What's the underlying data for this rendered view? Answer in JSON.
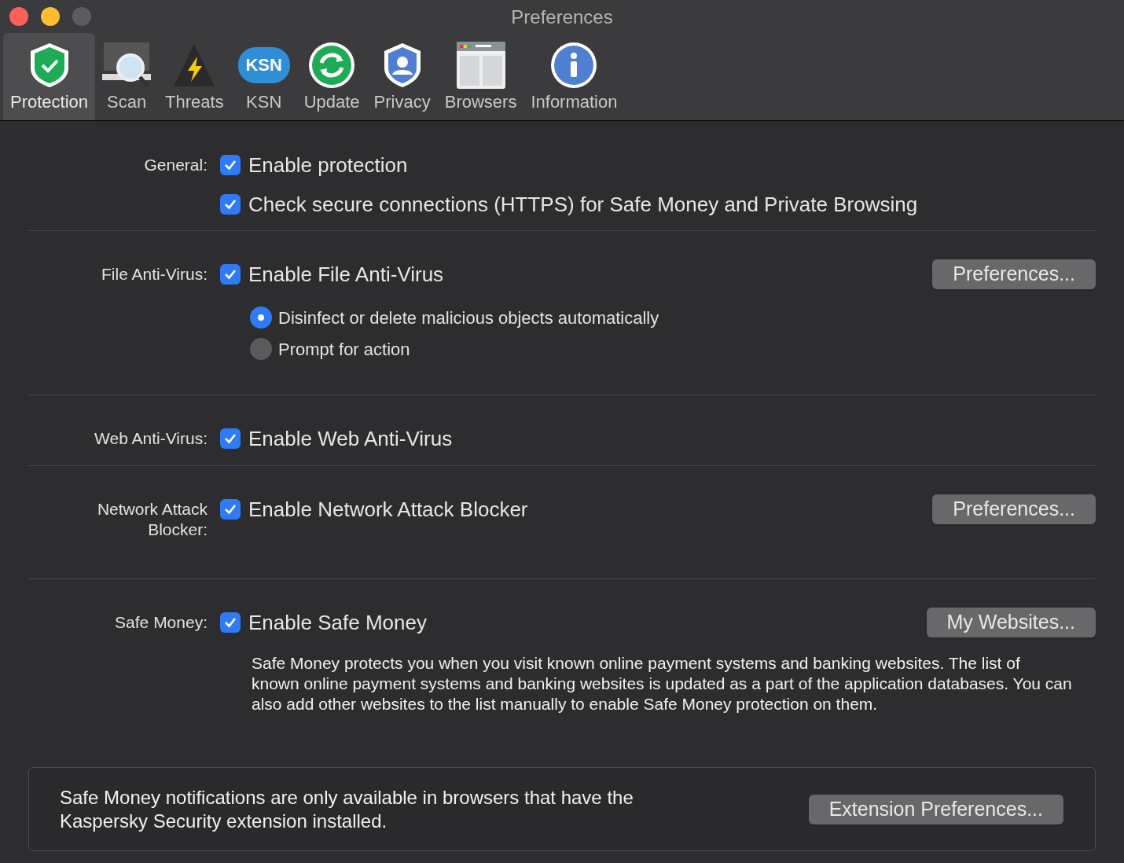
{
  "window": {
    "title": "Preferences"
  },
  "toolbar": [
    {
      "label": "Protection",
      "selected": true
    },
    {
      "label": "Scan",
      "selected": false
    },
    {
      "label": "Threats",
      "selected": false
    },
    {
      "label": "KSN",
      "icon_text": "KSN",
      "selected": false
    },
    {
      "label": "Update",
      "selected": false
    },
    {
      "label": "Privacy",
      "selected": false
    },
    {
      "label": "Browsers",
      "selected": false
    },
    {
      "label": "Information",
      "selected": false
    }
  ],
  "sections": [
    {
      "label": "General:",
      "checkboxes": [
        {
          "label": "Enable protection",
          "checked": true
        },
        {
          "label": "Check secure connections (HTTPS) for Safe Money and Private Browsing",
          "checked": true
        }
      ]
    },
    {
      "label": "File Anti-Virus:",
      "checkboxes": [
        {
          "label": "Enable File Anti-Virus",
          "checked": true
        }
      ],
      "button": "Preferences...",
      "radios": [
        {
          "label": "Disinfect or delete malicious objects automatically",
          "selected": true
        },
        {
          "label": "Prompt for action",
          "selected": false
        }
      ]
    },
    {
      "label": "Web Anti-Virus:",
      "checkboxes": [
        {
          "label": "Enable Web Anti-Virus",
          "checked": true
        }
      ]
    },
    {
      "label": "Network Attack Blocker:",
      "checkboxes": [
        {
          "label": "Enable Network Attack Blocker",
          "checked": true
        }
      ],
      "button": "Preferences..."
    },
    {
      "label": "Safe Money:",
      "checkboxes": [
        {
          "label": "Enable Safe Money",
          "checked": true
        }
      ],
      "button": "My Websites...",
      "description": "Safe Money protects you when you visit known online payment systems and banking websites. The list of known online payment systems and banking websites is updated as a part of the application databases. You can also add other websites to the list manually to enable Safe Money protection on them."
    }
  ],
  "notice": {
    "text": "Safe Money notifications are only available in browsers that have the Kaspersky Security extension installed.",
    "button": "Extension Preferences..."
  }
}
